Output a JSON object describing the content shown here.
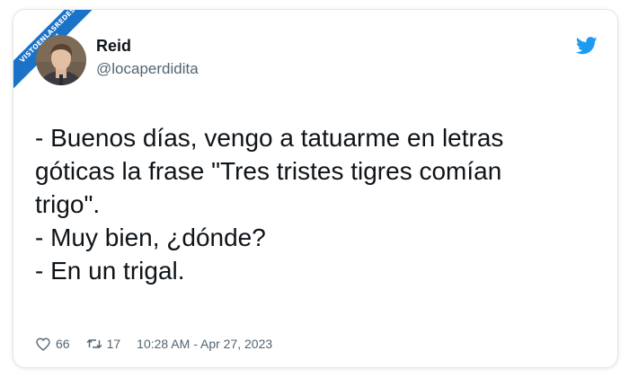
{
  "watermark": {
    "line1": "VISTOENLASREDES",
    "line2": ".COM"
  },
  "author": {
    "name": "Reid",
    "handle": "@locaperdidita"
  },
  "tweet": {
    "lines": [
      "- Buenos días, vengo a tatuarme en letras",
      "góticas la frase \"Tres tristes tigres comían",
      "trigo\".",
      "- Muy bien, ¿dónde?",
      "- En un trigal."
    ]
  },
  "stats": {
    "likes": "66",
    "retweets": "17",
    "timestamp": "10:28 AM - Apr 27, 2023"
  },
  "colors": {
    "twitter_blue": "#1d9bf0",
    "ribbon_blue": "#1a73c9",
    "text": "#0f1419",
    "muted": "#536471"
  },
  "icons": {
    "brand": "twitter-bird-icon",
    "like": "heart-icon",
    "retweet": "retweet-icon"
  }
}
